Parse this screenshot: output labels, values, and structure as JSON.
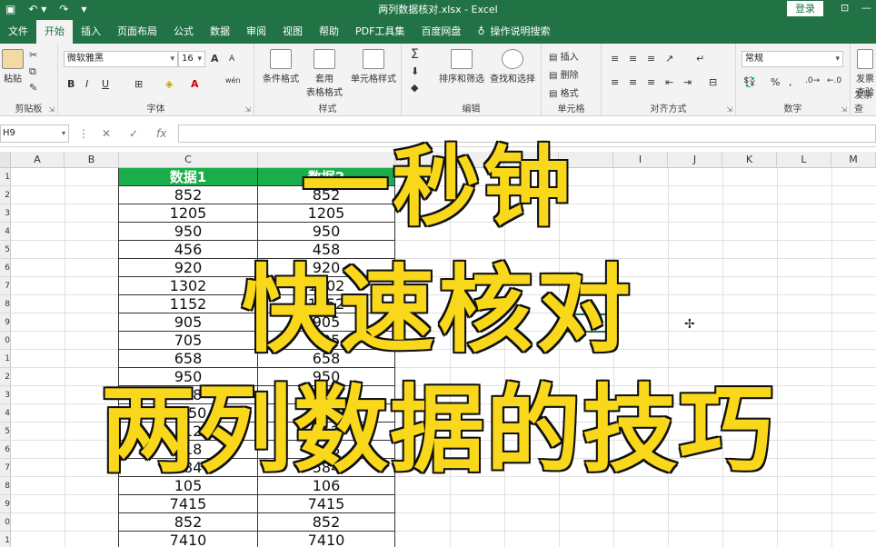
{
  "titlebar": {
    "save_icon": "save-icon",
    "undo_icon": "undo-icon",
    "redo_icon": "redo-icon",
    "title": "两列数据核对.xlsx  -  Excel",
    "login": "登录",
    "restore_icon": "ribbon-display-icon",
    "minimize": "—",
    "maximize": "□"
  },
  "tabs": [
    {
      "label": "文件"
    },
    {
      "label": "开始"
    },
    {
      "label": "插入"
    },
    {
      "label": "页面布局"
    },
    {
      "label": "公式"
    },
    {
      "label": "数据"
    },
    {
      "label": "审阅"
    },
    {
      "label": "视图"
    },
    {
      "label": "帮助"
    },
    {
      "label": "PDF工具集"
    },
    {
      "label": "百度网盘"
    },
    {
      "label": "操作说明搜索"
    }
  ],
  "ribbon": {
    "clipboard": {
      "paste": "粘贴",
      "label": "剪贴板"
    },
    "font": {
      "name": "微软雅黑",
      "size": "16",
      "label": "字体",
      "bold": "B",
      "italic": "I",
      "underline": "U",
      "grow": "A",
      "shrink": "A",
      "wen": "wén"
    },
    "styles": {
      "cond": "条件格式",
      "table": "套用",
      "table2": "表格格式",
      "cell": "单元格样式",
      "label": "样式"
    },
    "editing": {
      "sort": "排序和筛选",
      "find": "查找和选择",
      "label": "编辑"
    },
    "cells": {
      "insert": "插入",
      "delete": "删除",
      "format": "格式",
      "label": "单元格"
    },
    "align": {
      "label": "对齐方式"
    },
    "number": {
      "format": "常规",
      "label": "数字",
      "percent": "%",
      "comma": ","
    },
    "invoice": {
      "btn": "发票",
      "btn2": "查验",
      "label": "发票查"
    }
  },
  "formula_bar": {
    "namebox": "H9",
    "cancel": "✕",
    "confirm": "✓",
    "fx": "fx",
    "value": ""
  },
  "columns": [
    "A",
    "B",
    "C",
    "",
    "",
    "",
    "",
    "I",
    "J",
    "K",
    "L",
    "M"
  ],
  "rows": [
    "1",
    "2",
    "3",
    "4",
    "5",
    "6",
    "7",
    "8",
    "9",
    "0",
    "1",
    "2",
    "3",
    "4",
    "5",
    "6",
    "7",
    "8",
    "9",
    "0",
    "1"
  ],
  "table": {
    "header": [
      "数据1",
      "数据2"
    ],
    "rows": [
      [
        "852",
        "852"
      ],
      [
        "1205",
        "1205"
      ],
      [
        "950",
        "950"
      ],
      [
        "456",
        "458"
      ],
      [
        "920",
        "920"
      ],
      [
        "1302",
        "1302"
      ],
      [
        "1152",
        "1152"
      ],
      [
        "905",
        "905"
      ],
      [
        "705",
        "705"
      ],
      [
        "658",
        "658"
      ],
      [
        "950",
        "950"
      ],
      [
        "558",
        "558"
      ],
      [
        "1450",
        "1450"
      ],
      [
        "712",
        "712"
      ],
      [
        "418",
        "418"
      ],
      [
        "584",
        "584"
      ],
      [
        "105",
        "106"
      ],
      [
        "7415",
        "7415"
      ],
      [
        "852",
        "852"
      ],
      [
        "7410",
        "7410"
      ]
    ]
  },
  "overlay": {
    "line1": "一秒钟",
    "line2": "快速核对",
    "line3": "两列数据的技巧"
  },
  "colors": {
    "excel_green": "#217346",
    "header_green": "#1aad4b",
    "overlay_yellow": "#f9d81c"
  }
}
